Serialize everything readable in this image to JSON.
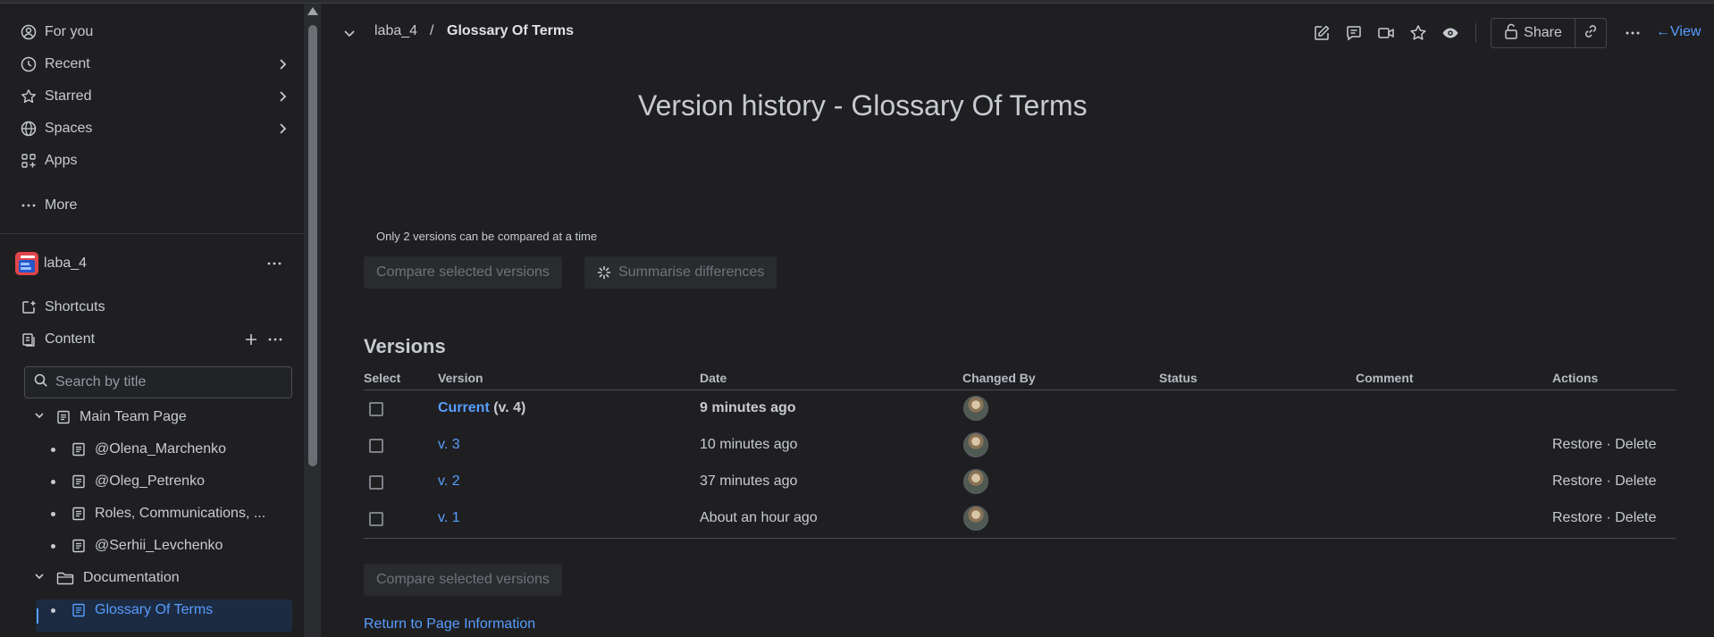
{
  "sidebar": {
    "nav": [
      {
        "label": "For you",
        "icon": "user-circle-icon"
      },
      {
        "label": "Recent",
        "icon": "clock-icon"
      },
      {
        "label": "Starred",
        "icon": "star-icon"
      },
      {
        "label": "Spaces",
        "icon": "globe-icon"
      },
      {
        "label": "Apps",
        "icon": "apps-icon"
      },
      {
        "label": "More",
        "icon": "more-dots-icon"
      }
    ],
    "space_name": "laba_4",
    "shortcuts_label": "Shortcuts",
    "content_label": "Content",
    "search_placeholder": "Search by title",
    "tree": [
      {
        "label": "Main Team Page"
      },
      {
        "label": "@Olena_Marchenko"
      },
      {
        "label": "@Oleg_Petrenko"
      },
      {
        "label": "Roles, Communications, ..."
      },
      {
        "label": "@Serhii_Levchenko"
      },
      {
        "label": "Documentation"
      },
      {
        "label": "Glossary Of Terms"
      }
    ]
  },
  "header": {
    "breadcrumb_space": "laba_4",
    "breadcrumb_sep": "/",
    "breadcrumb_page": "Glossary Of Terms",
    "share_label": "Share",
    "view_label": "View",
    "view_arrow": "←"
  },
  "main": {
    "title": "Version history - Glossary Of Terms",
    "compare_note": "Only 2 versions can be compared at a time",
    "compare_button": "Compare selected versions",
    "summarise_button": "Summarise differences",
    "versions_heading": "Versions",
    "columns": [
      "Select",
      "Version",
      "Date",
      "Changed By",
      "Status",
      "Comment",
      "Actions"
    ],
    "rows": [
      {
        "version_link": "Current",
        "version_suffix": " (v. 4)",
        "date": "9 minutes ago",
        "restore": "",
        "dot": "",
        "delete": ""
      },
      {
        "version_link": "v. 3",
        "version_suffix": "",
        "date": "10 minutes ago",
        "restore": "Restore",
        "dot": " · ",
        "delete": "Delete"
      },
      {
        "version_link": "v. 2",
        "version_suffix": "",
        "date": "37 minutes ago",
        "restore": "Restore",
        "dot": " · ",
        "delete": "Delete"
      },
      {
        "version_link": "v. 1",
        "version_suffix": "",
        "date": "About an hour ago",
        "restore": "Restore",
        "dot": " · ",
        "delete": "Delete"
      }
    ],
    "return_link": "Return to Page Information"
  },
  "colors": {
    "background": "#1f1f21",
    "link": "#579dff",
    "space_logo": "#e0464a",
    "active_row": "#1c2b41"
  }
}
